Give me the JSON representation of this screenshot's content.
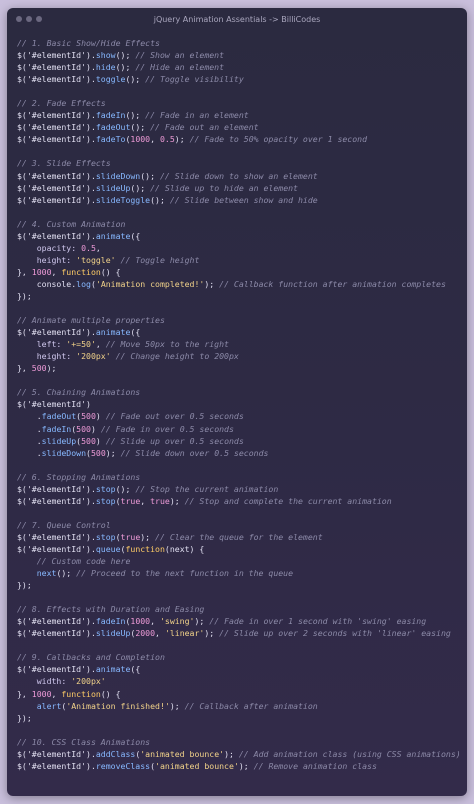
{
  "window": {
    "title": "jQuery Animation Assentials -> BilliCodes",
    "buttons": [
      "close",
      "minimize",
      "maximize"
    ]
  },
  "code_lines": [
    [
      {
        "t": "// 1. Basic Show/Hide Effects",
        "c": "cm"
      }
    ],
    [
      {
        "t": "$('#elementId')."
      },
      {
        "t": "show",
        "c": "fn"
      },
      {
        "t": "(); "
      },
      {
        "t": "// Show an element",
        "c": "cm"
      }
    ],
    [
      {
        "t": "$('#elementId')."
      },
      {
        "t": "hide",
        "c": "fn"
      },
      {
        "t": "(); "
      },
      {
        "t": "// Hide an element",
        "c": "cm"
      }
    ],
    [
      {
        "t": "$('#elementId')."
      },
      {
        "t": "toggle",
        "c": "fn"
      },
      {
        "t": "(); "
      },
      {
        "t": "// Toggle visibility",
        "c": "cm"
      }
    ],
    [],
    [
      {
        "t": "// 2. Fade Effects",
        "c": "cm"
      }
    ],
    [
      {
        "t": "$('#elementId')."
      },
      {
        "t": "fadeIn",
        "c": "fn"
      },
      {
        "t": "(); "
      },
      {
        "t": "// Fade in an element",
        "c": "cm"
      }
    ],
    [
      {
        "t": "$('#elementId')."
      },
      {
        "t": "fadeOut",
        "c": "fn"
      },
      {
        "t": "(); "
      },
      {
        "t": "// Fade out an element",
        "c": "cm"
      }
    ],
    [
      {
        "t": "$('#elementId')."
      },
      {
        "t": "fadeTo",
        "c": "fn"
      },
      {
        "t": "("
      },
      {
        "t": "1000",
        "c": "num"
      },
      {
        "t": ", "
      },
      {
        "t": "0.5",
        "c": "num"
      },
      {
        "t": "); "
      },
      {
        "t": "// Fade to 50% opacity over 1 second",
        "c": "cm"
      }
    ],
    [],
    [
      {
        "t": "// 3. Slide Effects",
        "c": "cm"
      }
    ],
    [
      {
        "t": "$('#elementId')."
      },
      {
        "t": "slideDown",
        "c": "fn"
      },
      {
        "t": "(); "
      },
      {
        "t": "// Slide down to show an element",
        "c": "cm"
      }
    ],
    [
      {
        "t": "$('#elementId')."
      },
      {
        "t": "slideUp",
        "c": "fn"
      },
      {
        "t": "(); "
      },
      {
        "t": "// Slide up to hide an element",
        "c": "cm"
      }
    ],
    [
      {
        "t": "$('#elementId')."
      },
      {
        "t": "slideToggle",
        "c": "fn"
      },
      {
        "t": "(); "
      },
      {
        "t": "// Slide between show and hide",
        "c": "cm"
      }
    ],
    [],
    [
      {
        "t": "// 4. Custom Animation",
        "c": "cm"
      }
    ],
    [
      {
        "t": "$('#elementId')."
      },
      {
        "t": "animate",
        "c": "fn"
      },
      {
        "t": "({"
      }
    ],
    [
      {
        "t": "    opacity: ",
        "c": "pr"
      },
      {
        "t": "0.5",
        "c": "num"
      },
      {
        "t": ","
      }
    ],
    [
      {
        "t": "    height: ",
        "c": "pr"
      },
      {
        "t": "'toggle'",
        "c": "str"
      },
      {
        "t": " "
      },
      {
        "t": "// Toggle height",
        "c": "cm"
      }
    ],
    [
      {
        "t": "}, "
      },
      {
        "t": "1000",
        "c": "num"
      },
      {
        "t": ", "
      },
      {
        "t": "function",
        "c": "kw"
      },
      {
        "t": "() {"
      }
    ],
    [
      {
        "t": "    console."
      },
      {
        "t": "log",
        "c": "fn"
      },
      {
        "t": "("
      },
      {
        "t": "'Animation completed!'",
        "c": "str"
      },
      {
        "t": "); "
      },
      {
        "t": "// Callback function after animation completes",
        "c": "cm"
      }
    ],
    [
      {
        "t": "});"
      }
    ],
    [],
    [
      {
        "t": "// Animate multiple properties",
        "c": "cm"
      }
    ],
    [
      {
        "t": "$('#elementId')."
      },
      {
        "t": "animate",
        "c": "fn"
      },
      {
        "t": "({"
      }
    ],
    [
      {
        "t": "    left: ",
        "c": "pr"
      },
      {
        "t": "'+=50'",
        "c": "str"
      },
      {
        "t": ", "
      },
      {
        "t": "// Move 50px to the right",
        "c": "cm"
      }
    ],
    [
      {
        "t": "    height: ",
        "c": "pr"
      },
      {
        "t": "'200px'",
        "c": "str"
      },
      {
        "t": " "
      },
      {
        "t": "// Change height to 200px",
        "c": "cm"
      }
    ],
    [
      {
        "t": "}, "
      },
      {
        "t": "500",
        "c": "num"
      },
      {
        "t": ");"
      }
    ],
    [],
    [
      {
        "t": "// 5. Chaining Animations",
        "c": "cm"
      }
    ],
    [
      {
        "t": "$('#elementId')"
      }
    ],
    [
      {
        "t": "    ."
      },
      {
        "t": "fadeOut",
        "c": "fn"
      },
      {
        "t": "("
      },
      {
        "t": "500",
        "c": "num"
      },
      {
        "t": ") "
      },
      {
        "t": "// Fade out over 0.5 seconds",
        "c": "cm"
      }
    ],
    [
      {
        "t": "    ."
      },
      {
        "t": "fadeIn",
        "c": "fn"
      },
      {
        "t": "("
      },
      {
        "t": "500",
        "c": "num"
      },
      {
        "t": ") "
      },
      {
        "t": "// Fade in over 0.5 seconds",
        "c": "cm"
      }
    ],
    [
      {
        "t": "    ."
      },
      {
        "t": "slideUp",
        "c": "fn"
      },
      {
        "t": "("
      },
      {
        "t": "500",
        "c": "num"
      },
      {
        "t": ") "
      },
      {
        "t": "// Slide up over 0.5 seconds",
        "c": "cm"
      }
    ],
    [
      {
        "t": "    ."
      },
      {
        "t": "slideDown",
        "c": "fn"
      },
      {
        "t": "("
      },
      {
        "t": "500",
        "c": "num"
      },
      {
        "t": "); "
      },
      {
        "t": "// Slide down over 0.5 seconds",
        "c": "cm"
      }
    ],
    [],
    [
      {
        "t": "// 6. Stopping Animations",
        "c": "cm"
      }
    ],
    [
      {
        "t": "$('#elementId')."
      },
      {
        "t": "stop",
        "c": "fn"
      },
      {
        "t": "(); "
      },
      {
        "t": "// Stop the current animation",
        "c": "cm"
      }
    ],
    [
      {
        "t": "$('#elementId')."
      },
      {
        "t": "stop",
        "c": "fn"
      },
      {
        "t": "("
      },
      {
        "t": "true",
        "c": "num"
      },
      {
        "t": ", "
      },
      {
        "t": "true",
        "c": "num"
      },
      {
        "t": "); "
      },
      {
        "t": "// Stop and complete the current animation",
        "c": "cm"
      }
    ],
    [],
    [
      {
        "t": "// 7. Queue Control",
        "c": "cm"
      }
    ],
    [
      {
        "t": "$('#elementId')."
      },
      {
        "t": "stop",
        "c": "fn"
      },
      {
        "t": "("
      },
      {
        "t": "true",
        "c": "num"
      },
      {
        "t": "); "
      },
      {
        "t": "// Clear the queue for the element",
        "c": "cm"
      }
    ],
    [
      {
        "t": "$('#elementId')."
      },
      {
        "t": "queue",
        "c": "fn"
      },
      {
        "t": "("
      },
      {
        "t": "function",
        "c": "kw"
      },
      {
        "t": "(next) {"
      }
    ],
    [
      {
        "t": "    "
      },
      {
        "t": "// Custom code here",
        "c": "cm"
      }
    ],
    [
      {
        "t": "    "
      },
      {
        "t": "next",
        "c": "fn"
      },
      {
        "t": "(); "
      },
      {
        "t": "// Proceed to the next function in the queue",
        "c": "cm"
      }
    ],
    [
      {
        "t": "});"
      }
    ],
    [],
    [
      {
        "t": "// 8. Effects with Duration and Easing",
        "c": "cm"
      }
    ],
    [
      {
        "t": "$('#elementId')."
      },
      {
        "t": "fadeIn",
        "c": "fn"
      },
      {
        "t": "("
      },
      {
        "t": "1000",
        "c": "num"
      },
      {
        "t": ", "
      },
      {
        "t": "'swing'",
        "c": "str"
      },
      {
        "t": "); "
      },
      {
        "t": "// Fade in over 1 second with 'swing' easing",
        "c": "cm"
      }
    ],
    [
      {
        "t": "$('#elementId')."
      },
      {
        "t": "slideUp",
        "c": "fn"
      },
      {
        "t": "("
      },
      {
        "t": "2000",
        "c": "num"
      },
      {
        "t": ", "
      },
      {
        "t": "'linear'",
        "c": "str"
      },
      {
        "t": "); "
      },
      {
        "t": "// Slide up over 2 seconds with 'linear' easing",
        "c": "cm"
      }
    ],
    [],
    [
      {
        "t": "// 9. Callbacks and Completion",
        "c": "cm"
      }
    ],
    [
      {
        "t": "$('#elementId')."
      },
      {
        "t": "animate",
        "c": "fn"
      },
      {
        "t": "({"
      }
    ],
    [
      {
        "t": "    width: ",
        "c": "pr"
      },
      {
        "t": "'200px'",
        "c": "str"
      }
    ],
    [
      {
        "t": "}, "
      },
      {
        "t": "1000",
        "c": "num"
      },
      {
        "t": ", "
      },
      {
        "t": "function",
        "c": "kw"
      },
      {
        "t": "() {"
      }
    ],
    [
      {
        "t": "    "
      },
      {
        "t": "alert",
        "c": "fn"
      },
      {
        "t": "("
      },
      {
        "t": "'Animation finished!'",
        "c": "str"
      },
      {
        "t": "); "
      },
      {
        "t": "// Callback after animation",
        "c": "cm"
      }
    ],
    [
      {
        "t": "});"
      }
    ],
    [],
    [
      {
        "t": "// 10. CSS Class Animations",
        "c": "cm"
      }
    ],
    [
      {
        "t": "$('#elementId')."
      },
      {
        "t": "addClass",
        "c": "fn"
      },
      {
        "t": "("
      },
      {
        "t": "'animated bounce'",
        "c": "str"
      },
      {
        "t": "); "
      },
      {
        "t": "// Add animation class (using CSS animations)",
        "c": "cm"
      }
    ],
    [
      {
        "t": "$('#elementId')."
      },
      {
        "t": "removeClass",
        "c": "fn"
      },
      {
        "t": "("
      },
      {
        "t": "'animated bounce'",
        "c": "str"
      },
      {
        "t": "); "
      },
      {
        "t": "// Remove animation class",
        "c": "cm"
      }
    ]
  ]
}
